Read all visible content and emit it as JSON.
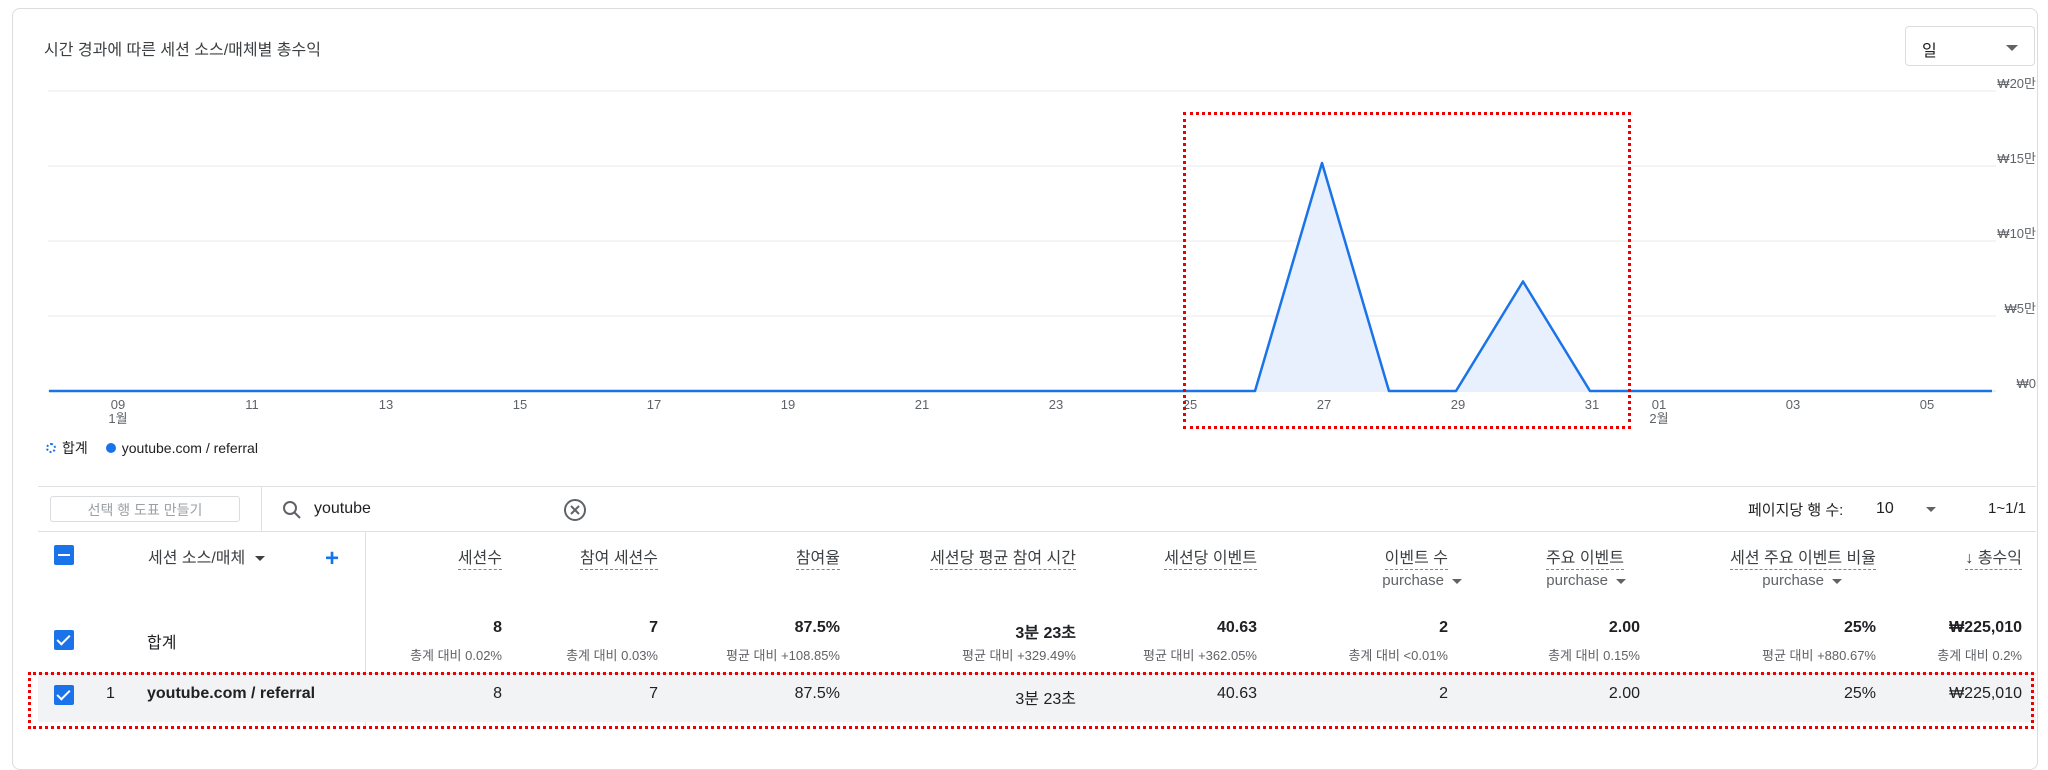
{
  "card": {
    "title": "시간 경과에 따른 세션 소스/매체별 총수익"
  },
  "granularity": {
    "value": "일"
  },
  "chart_data": {
    "type": "area",
    "x": [
      "01-08",
      "01-09",
      "01-10",
      "01-11",
      "01-12",
      "01-13",
      "01-14",
      "01-15",
      "01-16",
      "01-17",
      "01-18",
      "01-19",
      "01-20",
      "01-21",
      "01-22",
      "01-23",
      "01-24",
      "01-25",
      "01-26",
      "01-27",
      "01-28",
      "01-29",
      "01-30",
      "01-31",
      "02-01",
      "02-02",
      "02-03",
      "02-04",
      "02-05",
      "02-06"
    ],
    "series": [
      {
        "name": "youtube.com / referral",
        "values": [
          0,
          0,
          0,
          0,
          0,
          0,
          0,
          0,
          0,
          0,
          0,
          0,
          0,
          0,
          0,
          0,
          0,
          0,
          0,
          152000,
          0,
          0,
          73000,
          0,
          0,
          0,
          0,
          0,
          0,
          0
        ]
      }
    ],
    "x_tick_labels": [
      {
        "day": "09",
        "month": "1월",
        "index": 1
      },
      {
        "day": "11",
        "month": "",
        "index": 3
      },
      {
        "day": "13",
        "month": "",
        "index": 5
      },
      {
        "day": "15",
        "month": "",
        "index": 7
      },
      {
        "day": "17",
        "month": "",
        "index": 9
      },
      {
        "day": "19",
        "month": "",
        "index": 11
      },
      {
        "day": "21",
        "month": "",
        "index": 13
      },
      {
        "day": "23",
        "month": "",
        "index": 15
      },
      {
        "day": "25",
        "month": "",
        "index": 17
      },
      {
        "day": "27",
        "month": "",
        "index": 19
      },
      {
        "day": "29",
        "month": "",
        "index": 21
      },
      {
        "day": "31",
        "month": "",
        "index": 23
      },
      {
        "day": "01",
        "month": "2월",
        "index": 24
      },
      {
        "day": "03",
        "month": "",
        "index": 26
      },
      {
        "day": "05",
        "month": "",
        "index": 28
      }
    ],
    "y_ticks": [
      {
        "value": 0,
        "label": "₩0"
      },
      {
        "value": 50000,
        "label": "₩5만"
      },
      {
        "value": 100000,
        "label": "₩10만"
      },
      {
        "value": 150000,
        "label": "₩15만"
      },
      {
        "value": 200000,
        "label": "₩20만"
      }
    ],
    "ylim": [
      0,
      200000
    ],
    "y_axis_side": "right",
    "grid": true,
    "legend": [
      "합계",
      "youtube.com / referral"
    ],
    "colors": {
      "line": "#1a73e8",
      "fill": "#e8f0fe"
    },
    "highlight_range": [
      "01-25",
      "01-31"
    ]
  },
  "legend": {
    "total": "합계",
    "series": "youtube.com / referral"
  },
  "toolbar": {
    "select_rows_button": "선택 행 도표 만들기",
    "search_value": "youtube",
    "rows_per_page_label": "페이지당 행 수:",
    "rows_per_page": "10",
    "pagination": "1~1/1"
  },
  "table": {
    "dimension_header": "세션 소스/매체",
    "columns": [
      {
        "label": "세션수",
        "sub": ""
      },
      {
        "label": "참여 세션수",
        "sub": ""
      },
      {
        "label": "참여율",
        "sub": ""
      },
      {
        "label": "세션당 평균 참여 시간",
        "sub": ""
      },
      {
        "label": "세션당 이벤트",
        "sub": ""
      },
      {
        "label": "이벤트 수",
        "sub": "purchase"
      },
      {
        "label": "주요 이벤트",
        "sub": "purchase"
      },
      {
        "label": "세션 주요 이벤트 비율",
        "sub": "purchase"
      },
      {
        "label": "↓ 총수익",
        "sub": ""
      }
    ],
    "total": {
      "label": "합계",
      "values": [
        "8",
        "7",
        "87.5%",
        "3분 23초",
        "40.63",
        "2",
        "2.00",
        "25%",
        "₩225,010"
      ],
      "compare": [
        "총계 대비 0.02%",
        "총계 대비 0.03%",
        "평균 대비 +108.85%",
        "평균 대비 +329.49%",
        "평균 대비 +362.05%",
        "총계 대비 <0.01%",
        "총계 대비 0.15%",
        "평균 대비 +880.67%",
        "총계 대비 0.2%"
      ]
    },
    "rows": [
      {
        "index": "1",
        "dimension": "youtube.com / referral",
        "values": [
          "8",
          "7",
          "87.5%",
          "3분 23초",
          "40.63",
          "2",
          "2.00",
          "25%",
          "₩225,010"
        ]
      }
    ]
  }
}
